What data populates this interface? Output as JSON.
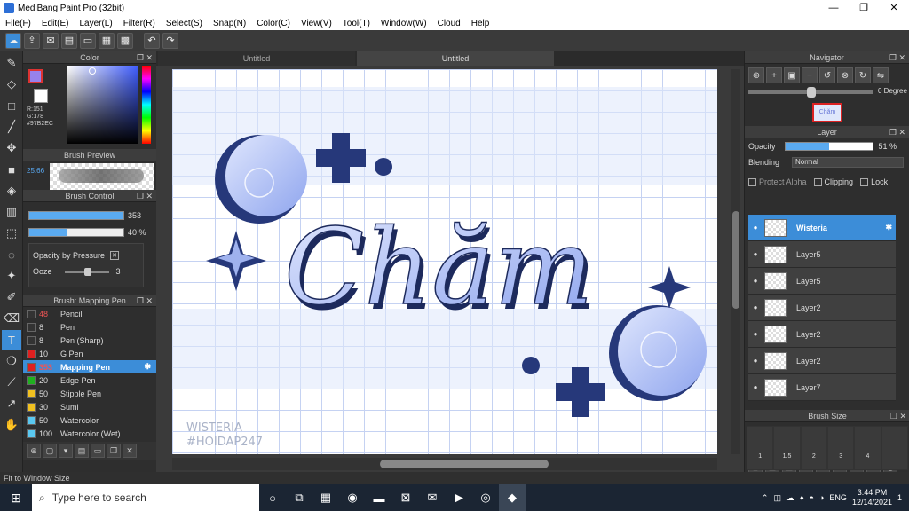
{
  "window": {
    "title": "MediBang Paint Pro (32bit)",
    "minimize": "—",
    "maximize": "❐",
    "close": "✕"
  },
  "menu": [
    "File(F)",
    "Edit(E)",
    "Layer(L)",
    "Filter(R)",
    "Select(S)",
    "Snap(N)",
    "Color(C)",
    "View(V)",
    "Tool(T)",
    "Window(W)",
    "Cloud",
    "Help"
  ],
  "color_panel": {
    "title": "Color",
    "rgb": "R:151\nG:178\n#97B2EC",
    "fg": "#9782ec"
  },
  "brush_preview": {
    "title": "Brush Preview",
    "size": "25.66"
  },
  "brush_control": {
    "title": "Brush Control",
    "size_val": "353",
    "opacity_val": "40 %",
    "opacity_pressure": "Opacity by Pressure",
    "ooze_label": "Ooze",
    "ooze_val": "3",
    "ooze_check": "✕"
  },
  "brush_list": {
    "title": "Brush: Mapping Pen",
    "items": [
      {
        "num": "48",
        "name": "Pencil",
        "color": "#333"
      },
      {
        "num": "8",
        "name": "Pen",
        "color": "#333"
      },
      {
        "num": "8",
        "name": "Pen (Sharp)",
        "color": "#333"
      },
      {
        "num": "10",
        "name": "G Pen",
        "color": "#e02020"
      },
      {
        "num": "353",
        "name": "Mapping Pen",
        "color": "#e02020"
      },
      {
        "num": "20",
        "name": "Edge Pen",
        "color": "#20b020"
      },
      {
        "num": "50",
        "name": "Stipple Pen",
        "color": "#f0c020"
      },
      {
        "num": "30",
        "name": "Sumi",
        "color": "#f0c020"
      },
      {
        "num": "50",
        "name": "Watercolor",
        "color": "#5ac8f0"
      },
      {
        "num": "100",
        "name": "Watercolor (Wet)",
        "color": "#5ac8f0"
      }
    ]
  },
  "tabs": [
    "Untitled",
    "Untitled"
  ],
  "canvas": {
    "word": "Chăm",
    "watermark1": "WISTERIA",
    "watermark2": "#HOIDAP247"
  },
  "navigator": {
    "title": "Navigator",
    "degree": "0 Degree",
    "thumb_text": "Chăm"
  },
  "layer_panel": {
    "title": "Layer",
    "opacity_label": "Opacity",
    "opacity_val": "51 %",
    "opacity_level": 0.51,
    "blending_label": "Blending",
    "blending_val": "Normal",
    "protect_alpha": "Protect Alpha",
    "clipping": "Clipping",
    "lock": "Lock",
    "layers": [
      {
        "name": "Wisteria"
      },
      {
        "name": "Layer5"
      },
      {
        "name": "Layer5"
      },
      {
        "name": "Layer2"
      },
      {
        "name": "Layer2"
      },
      {
        "name": "Layer2"
      },
      {
        "name": "Layer7"
      }
    ]
  },
  "brush_size": {
    "title": "Brush Size",
    "sizes": [
      "1",
      "1.5",
      "2",
      "3",
      "4",
      ""
    ]
  },
  "status": "Fit to Window Size",
  "taskbar": {
    "search_placeholder": "Type here to search",
    "lang": "ENG",
    "time": "3:44 PM",
    "date": "12/14/2021",
    "notif": "1"
  }
}
